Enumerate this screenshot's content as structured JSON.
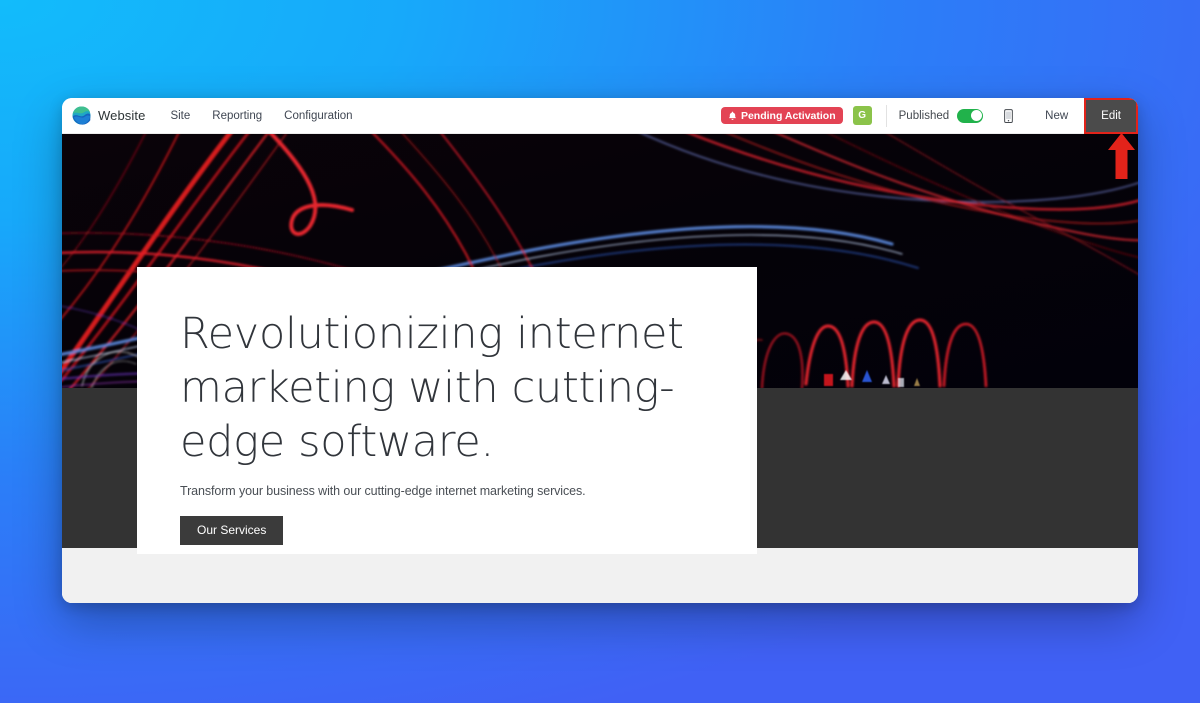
{
  "window": {
    "toolbar": {
      "brand_name": "Website",
      "logo_icon": "website-builder-logo-icon",
      "nav_links": [
        {
          "label": "Site"
        },
        {
          "label": "Reporting"
        },
        {
          "label": "Configuration"
        }
      ],
      "pending_badge": {
        "label": "Pending Activation",
        "icon": "bell-icon",
        "color": "#e34354"
      },
      "google_badge": {
        "label": "G",
        "icon": "google-analytics-icon",
        "color": "#8bc34a"
      },
      "published": {
        "label": "Published",
        "toggle_state": "on",
        "toggle_color": "#21b24b"
      },
      "mobile_preview_icon": "mobile-phone-icon",
      "new_button": "New",
      "edit_button": "Edit",
      "edit_highlight_color": "#e2231a"
    },
    "preview": {
      "hero": {
        "title": "Revolutionizing internet marketing with cutting-edge software.",
        "subtitle": "Transform your business with our cutting-edge internet marketing services.",
        "cta_label": "Our Services",
        "cta_color": "#3b3b3b",
        "background": "dark abstract red and blue light-trail photograph"
      },
      "band_color": "#333333",
      "footer_color": "#f1f1f1"
    }
  },
  "annotation": {
    "arrow": {
      "icon": "up-arrow-annotation-icon",
      "color": "#e2231a",
      "points_to": "Edit"
    }
  },
  "page_background": {
    "from": "#12bcfb",
    "to": "#4061f5"
  }
}
